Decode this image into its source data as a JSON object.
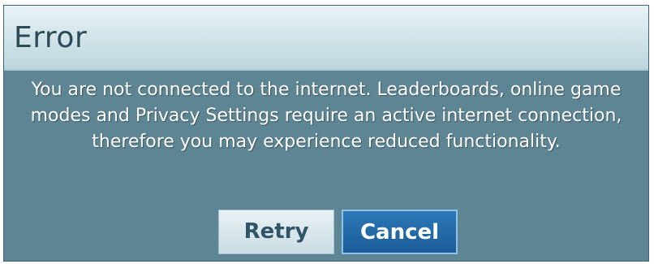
{
  "dialog": {
    "title": "Error",
    "message": "You are not connected to the internet. Leaderboards, online game modes and Privacy Settings require an active internet connection, therefore you may experience reduced functionality.",
    "buttons": {
      "retry_label": "Retry",
      "cancel_label": "Cancel"
    },
    "focused_button": "Cancel"
  },
  "colors": {
    "body_background": "#5d8593",
    "title_bar": "#cfe3e9",
    "title_text": "#2c4a57",
    "message_text": "#ffffff",
    "retry_button": "#c9dde4",
    "cancel_button_focused": "#1a5c98"
  }
}
